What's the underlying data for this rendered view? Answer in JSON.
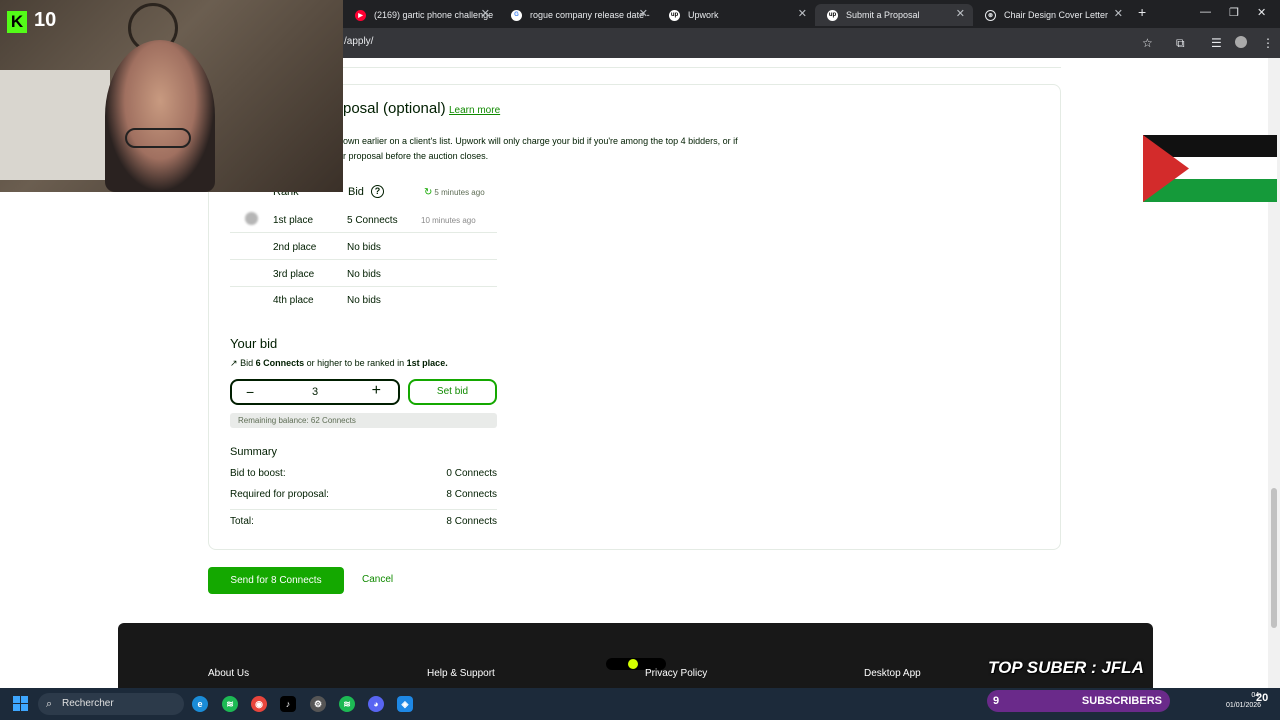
{
  "browser": {
    "tabs": [
      {
        "title": "(2169) gartic phone challenge",
        "favicon": "youtube-icon",
        "color": "#ff0033"
      },
      {
        "title": "rogue company release date - ",
        "favicon": "google-icon",
        "color": "#4285f4"
      },
      {
        "title": "Upwork",
        "favicon": "upwork-icon",
        "color": "#14a800"
      },
      {
        "title": "Submit a Proposal",
        "favicon": "upwork-icon",
        "color": "#14a800"
      },
      {
        "title": "Chair Design Cover Letter",
        "favicon": "chatgpt-icon",
        "color": "#ffffff"
      }
    ],
    "url": "/apply/"
  },
  "proposal": {
    "section_title": "posal (optional)",
    "learn_more": "Learn more",
    "desc_line1": "own earlier on a client's list. Upwork will only charge your bid if you're among the top 4 bidders, or if",
    "desc_line2": "r proposal before the auction closes.",
    "rank_header": "Rank",
    "bid_header": "Bid",
    "refresh_text": "5 minutes ago",
    "ranks": [
      {
        "place": "1st place",
        "bid": "5 Connects",
        "time": "10 minutes ago"
      },
      {
        "place": "2nd place",
        "bid": "No bids",
        "time": ""
      },
      {
        "place": "3rd place",
        "bid": "No bids",
        "time": ""
      },
      {
        "place": "4th place",
        "bid": "No bids",
        "time": ""
      }
    ],
    "your_bid_title": "Your bid",
    "hint_prefix": "Bid ",
    "hint_connects": "6 Connects",
    "hint_middle": " or higher to be ranked in ",
    "hint_place": "1st place.",
    "bid_value": "3",
    "set_bid": "Set bid",
    "balance": "Remaining balance: 62 Connects",
    "summary_title": "Summary",
    "summary": [
      {
        "label": "Bid to boost:",
        "value": "0 Connects"
      },
      {
        "label": "Required for proposal:",
        "value": "8 Connects"
      }
    ],
    "total_label": "Total:",
    "total_value": "8 Connects",
    "send_button": "Send for 8 Connects",
    "cancel_button": "Cancel"
  },
  "footer": {
    "links": [
      "About Us",
      "Help & Support",
      "Privacy Policy",
      "Desktop App"
    ]
  },
  "overlay": {
    "kick_count": "10",
    "top_suber": "TOP SUBER : JFLA",
    "subs_count": "9",
    "subs_label": "SUBSCRIBERS"
  },
  "taskbar": {
    "search": "Rechercher",
    "time_small": "04:",
    "time_big": "20",
    "date": "01/01/2026"
  },
  "colors": {
    "upwork_green": "#14a800",
    "link_green": "#108a00"
  }
}
